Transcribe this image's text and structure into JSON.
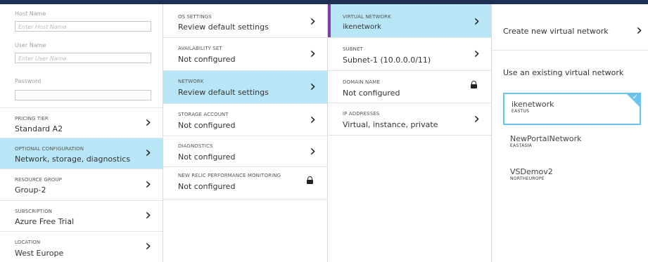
{
  "column1": {
    "fields": [
      {
        "label": "Host Name",
        "placeholder": "Enter Host Name"
      },
      {
        "label": "User Name",
        "placeholder": "Enter User Name"
      },
      {
        "label": "Password",
        "placeholder": ""
      }
    ],
    "items": [
      {
        "label": "PRICING TIER",
        "value": "Standard A2"
      },
      {
        "label": "OPTIONAL CONFIGURATION",
        "value": "Network, storage, diagnostics"
      },
      {
        "label": "RESOURCE GROUP",
        "value": "Group-2"
      },
      {
        "label": "SUBSCRIPTION",
        "value": "Azure Free Trial"
      },
      {
        "label": "LOCATION",
        "value": "West Europe"
      }
    ]
  },
  "column2": {
    "items": [
      {
        "label": "OS SETTINGS",
        "value": "Review default settings"
      },
      {
        "label": "AVAILABILITY SET",
        "value": "Not configured"
      },
      {
        "label": "NETWORK",
        "value": "Review default settings"
      },
      {
        "label": "STORAGE ACCOUNT",
        "value": "Not configured"
      },
      {
        "label": "DIAGNOSTICS",
        "value": "Not configured"
      },
      {
        "label": "NEW RELIC PERFORMANCE MONITORING",
        "value": "Not configured"
      }
    ]
  },
  "column3": {
    "items": [
      {
        "label": "VIRTUAL NETWORK",
        "value": "ikenetwork"
      },
      {
        "label": "SUBNET",
        "value": "Subnet-1 (10.0.0.0/11)"
      },
      {
        "label": "DOMAIN NAME",
        "value": "Not configured"
      },
      {
        "label": "IP ADDRESSES",
        "value": "Virtual, instance, private"
      }
    ]
  },
  "column4": {
    "create_label": "Create new virtual network",
    "existing_label": "Use an existing virtual network",
    "networks": [
      {
        "name": "ikenetwork",
        "region": "EASTUS"
      },
      {
        "name": "NewPortalNetwork",
        "region": "EASTASIA"
      },
      {
        "name": "VSDemov2",
        "region": "NORTHEUROPE"
      }
    ]
  },
  "icons": {
    "chevron": "chevron-right-icon",
    "lock": "lock-icon",
    "check": "checkmark-icon"
  },
  "colors": {
    "selected_bg": "#b9e6f7",
    "accent": "#7b3fa5",
    "top_bar": "#1d2f52",
    "card_border": "#69c3ec"
  }
}
